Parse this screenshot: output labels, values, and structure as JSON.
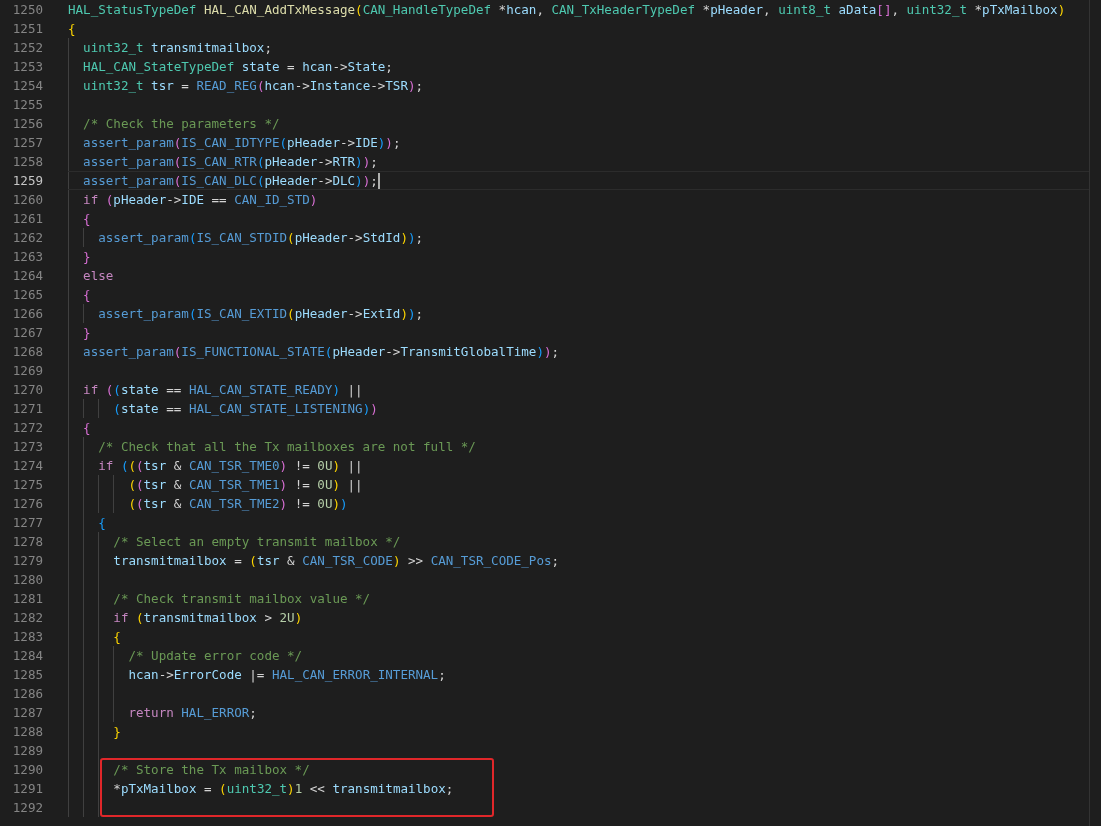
{
  "editor": {
    "lines": [
      {
        "number": "1250",
        "current": false,
        "boxed": false,
        "tokens": [
          {
            "kind": "type",
            "text": "HAL_StatusTypeDef"
          },
          {
            "kind": "function",
            "text": " HAL_CAN_AddTxMessage"
          },
          {
            "kind": "paren1",
            "text": "("
          },
          {
            "kind": "type",
            "text": "CAN_HandleTypeDef"
          },
          {
            "kind": "plain",
            "text": " *"
          },
          {
            "kind": "variable",
            "text": "hcan"
          },
          {
            "kind": "plain",
            "text": ", "
          },
          {
            "kind": "type",
            "text": "CAN_TxHeaderTypeDef"
          },
          {
            "kind": "plain",
            "text": " *"
          },
          {
            "kind": "variable",
            "text": "pHeader"
          },
          {
            "kind": "plain",
            "text": ", "
          },
          {
            "kind": "type",
            "text": "uint8_t"
          },
          {
            "kind": "variable",
            "text": " aData"
          },
          {
            "kind": "paren2",
            "text": "[]"
          },
          {
            "kind": "plain",
            "text": ", "
          },
          {
            "kind": "type",
            "text": "uint32_t"
          },
          {
            "kind": "plain",
            "text": " *"
          },
          {
            "kind": "variable",
            "text": "pTxMailbox"
          },
          {
            "kind": "paren1",
            "text": ")"
          }
        ]
      },
      {
        "number": "1251",
        "current": false,
        "boxed": false,
        "tokens": [
          {
            "kind": "paren1",
            "text": "{"
          }
        ]
      },
      {
        "number": "1252",
        "current": false,
        "boxed": false,
        "tokens": [
          {
            "kind": "type",
            "text": "  uint32_t"
          },
          {
            "kind": "variable",
            "text": " transmitmailbox"
          },
          {
            "kind": "plain",
            "text": ";"
          }
        ]
      },
      {
        "number": "1253",
        "current": false,
        "boxed": false,
        "tokens": [
          {
            "kind": "type",
            "text": "  HAL_CAN_StateTypeDef"
          },
          {
            "kind": "variable",
            "text": " state"
          },
          {
            "kind": "plain",
            "text": " = "
          },
          {
            "kind": "variable",
            "text": "hcan"
          },
          {
            "kind": "plain",
            "text": "->"
          },
          {
            "kind": "variable",
            "text": "State"
          },
          {
            "kind": "plain",
            "text": ";"
          }
        ]
      },
      {
        "number": "1254",
        "current": false,
        "boxed": false,
        "tokens": [
          {
            "kind": "type",
            "text": "  uint32_t"
          },
          {
            "kind": "variable",
            "text": " tsr"
          },
          {
            "kind": "plain",
            "text": " = "
          },
          {
            "kind": "macro",
            "text": "READ_REG"
          },
          {
            "kind": "paren2",
            "text": "("
          },
          {
            "kind": "variable",
            "text": "hcan"
          },
          {
            "kind": "plain",
            "text": "->"
          },
          {
            "kind": "variable",
            "text": "Instance"
          },
          {
            "kind": "plain",
            "text": "->"
          },
          {
            "kind": "variable",
            "text": "TSR"
          },
          {
            "kind": "paren2",
            "text": ")"
          },
          {
            "kind": "plain",
            "text": ";"
          }
        ]
      },
      {
        "number": "1255",
        "current": false,
        "boxed": false
      },
      {
        "number": "1256",
        "current": false,
        "boxed": false,
        "tokens": [
          {
            "kind": "comment",
            "text": "  /* Check the parameters */"
          }
        ]
      },
      {
        "number": "1257",
        "current": false,
        "boxed": false,
        "tokens": [
          {
            "kind": "macro",
            "text": "  assert_param"
          },
          {
            "kind": "paren2",
            "text": "("
          },
          {
            "kind": "macro",
            "text": "IS_CAN_IDTYPE"
          },
          {
            "kind": "paren3",
            "text": "("
          },
          {
            "kind": "variable",
            "text": "pHeader"
          },
          {
            "kind": "plain",
            "text": "->"
          },
          {
            "kind": "variable",
            "text": "IDE"
          },
          {
            "kind": "paren3",
            "text": ")"
          },
          {
            "kind": "paren2",
            "text": ")"
          },
          {
            "kind": "plain",
            "text": ";"
          }
        ]
      },
      {
        "number": "1258",
        "current": false,
        "boxed": false,
        "tokens": [
          {
            "kind": "macro",
            "text": "  assert_param"
          },
          {
            "kind": "paren2",
            "text": "("
          },
          {
            "kind": "macro",
            "text": "IS_CAN_RTR"
          },
          {
            "kind": "paren3",
            "text": "("
          },
          {
            "kind": "variable",
            "text": "pHeader"
          },
          {
            "kind": "plain",
            "text": "->"
          },
          {
            "kind": "variable",
            "text": "RTR"
          },
          {
            "kind": "paren3",
            "text": ")"
          },
          {
            "kind": "paren2",
            "text": ")"
          },
          {
            "kind": "plain",
            "text": ";"
          }
        ]
      },
      {
        "number": "1259",
        "current": true,
        "boxed": false,
        "tokens": [
          {
            "kind": "macro",
            "text": "  assert_param"
          },
          {
            "kind": "paren2",
            "text": "("
          },
          {
            "kind": "macro",
            "text": "IS_CAN_DLC"
          },
          {
            "kind": "paren3",
            "text": "("
          },
          {
            "kind": "variable",
            "text": "pHeader"
          },
          {
            "kind": "plain",
            "text": "->"
          },
          {
            "kind": "variable",
            "text": "DLC"
          },
          {
            "kind": "paren3",
            "text": ")"
          },
          {
            "kind": "paren2",
            "text": ")"
          },
          {
            "kind": "plain",
            "text": ";"
          }
        ]
      },
      {
        "number": "1260",
        "current": false,
        "boxed": false,
        "tokens": [
          {
            "kind": "keyword",
            "text": "  if"
          },
          {
            "kind": "paren2",
            "text": " ("
          },
          {
            "kind": "variable",
            "text": "pHeader"
          },
          {
            "kind": "plain",
            "text": "->"
          },
          {
            "kind": "variable",
            "text": "IDE"
          },
          {
            "kind": "plain",
            "text": " == "
          },
          {
            "kind": "macro",
            "text": "CAN_ID_STD"
          },
          {
            "kind": "paren2",
            "text": ")"
          }
        ]
      },
      {
        "number": "1261",
        "current": false,
        "boxed": false,
        "tokens": [
          {
            "kind": "paren2",
            "text": "  {"
          }
        ]
      },
      {
        "number": "1262",
        "current": false,
        "boxed": false,
        "tokens": [
          {
            "kind": "macro",
            "text": "    assert_param"
          },
          {
            "kind": "paren3",
            "text": "("
          },
          {
            "kind": "macro",
            "text": "IS_CAN_STDID"
          },
          {
            "kind": "paren1",
            "text": "("
          },
          {
            "kind": "variable",
            "text": "pHeader"
          },
          {
            "kind": "plain",
            "text": "->"
          },
          {
            "kind": "variable",
            "text": "StdId"
          },
          {
            "kind": "paren1",
            "text": ")"
          },
          {
            "kind": "paren3",
            "text": ")"
          },
          {
            "kind": "plain",
            "text": ";"
          }
        ]
      },
      {
        "number": "1263",
        "current": false,
        "boxed": false,
        "tokens": [
          {
            "kind": "paren2",
            "text": "  }"
          }
        ]
      },
      {
        "number": "1264",
        "current": false,
        "boxed": false,
        "tokens": [
          {
            "kind": "keyword",
            "text": "  else"
          }
        ]
      },
      {
        "number": "1265",
        "current": false,
        "boxed": false,
        "tokens": [
          {
            "kind": "paren2",
            "text": "  {"
          }
        ]
      },
      {
        "number": "1266",
        "current": false,
        "boxed": false,
        "tokens": [
          {
            "kind": "macro",
            "text": "    assert_param"
          },
          {
            "kind": "paren3",
            "text": "("
          },
          {
            "kind": "macro",
            "text": "IS_CAN_EXTID"
          },
          {
            "kind": "paren1",
            "text": "("
          },
          {
            "kind": "variable",
            "text": "pHeader"
          },
          {
            "kind": "plain",
            "text": "->"
          },
          {
            "kind": "variable",
            "text": "ExtId"
          },
          {
            "kind": "paren1",
            "text": ")"
          },
          {
            "kind": "paren3",
            "text": ")"
          },
          {
            "kind": "plain",
            "text": ";"
          }
        ]
      },
      {
        "number": "1267",
        "current": false,
        "boxed": false,
        "tokens": [
          {
            "kind": "paren2",
            "text": "  }"
          }
        ]
      },
      {
        "number": "1268",
        "current": false,
        "boxed": false,
        "tokens": [
          {
            "kind": "macro",
            "text": "  assert_param"
          },
          {
            "kind": "paren2",
            "text": "("
          },
          {
            "kind": "macro",
            "text": "IS_FUNCTIONAL_STATE"
          },
          {
            "kind": "paren3",
            "text": "("
          },
          {
            "kind": "variable",
            "text": "pHeader"
          },
          {
            "kind": "plain",
            "text": "->"
          },
          {
            "kind": "variable",
            "text": "TransmitGlobalTime"
          },
          {
            "kind": "paren3",
            "text": ")"
          },
          {
            "kind": "paren2",
            "text": ")"
          },
          {
            "kind": "plain",
            "text": ";"
          }
        ]
      },
      {
        "number": "1269",
        "current": false,
        "boxed": false
      },
      {
        "number": "1270",
        "current": false,
        "boxed": false,
        "tokens": [
          {
            "kind": "keyword",
            "text": "  if"
          },
          {
            "kind": "paren2",
            "text": " ("
          },
          {
            "kind": "paren3",
            "text": "("
          },
          {
            "kind": "variable",
            "text": "state"
          },
          {
            "kind": "plain",
            "text": " == "
          },
          {
            "kind": "macro",
            "text": "HAL_CAN_STATE_READY"
          },
          {
            "kind": "paren3",
            "text": ")"
          },
          {
            "kind": "plain",
            "text": " ||"
          }
        ]
      },
      {
        "number": "1271",
        "current": false,
        "boxed": false,
        "tokens": [
          {
            "kind": "paren3",
            "text": "      ("
          },
          {
            "kind": "variable",
            "text": "state"
          },
          {
            "kind": "plain",
            "text": " == "
          },
          {
            "kind": "macro",
            "text": "HAL_CAN_STATE_LISTENING"
          },
          {
            "kind": "paren3",
            "text": ")"
          },
          {
            "kind": "paren2",
            "text": ")"
          }
        ]
      },
      {
        "number": "1272",
        "current": false,
        "boxed": false,
        "tokens": [
          {
            "kind": "paren2",
            "text": "  {"
          }
        ]
      },
      {
        "number": "1273",
        "current": false,
        "boxed": false,
        "tokens": [
          {
            "kind": "comment",
            "text": "    /* Check that all the Tx mailboxes are not full */"
          }
        ]
      },
      {
        "number": "1274",
        "current": false,
        "boxed": false,
        "tokens": [
          {
            "kind": "keyword",
            "text": "    if"
          },
          {
            "kind": "paren3",
            "text": " ("
          },
          {
            "kind": "paren1",
            "text": "("
          },
          {
            "kind": "paren2",
            "text": "("
          },
          {
            "kind": "variable",
            "text": "tsr"
          },
          {
            "kind": "plain",
            "text": " & "
          },
          {
            "kind": "macro",
            "text": "CAN_TSR_TME0"
          },
          {
            "kind": "paren2",
            "text": ")"
          },
          {
            "kind": "plain",
            "text": " != "
          },
          {
            "kind": "number",
            "text": "0U"
          },
          {
            "kind": "paren1",
            "text": ")"
          },
          {
            "kind": "plain",
            "text": " ||"
          }
        ]
      },
      {
        "number": "1275",
        "current": false,
        "boxed": false,
        "tokens": [
          {
            "kind": "paren1",
            "text": "        ("
          },
          {
            "kind": "paren2",
            "text": "("
          },
          {
            "kind": "variable",
            "text": "tsr"
          },
          {
            "kind": "plain",
            "text": " & "
          },
          {
            "kind": "macro",
            "text": "CAN_TSR_TME1"
          },
          {
            "kind": "paren2",
            "text": ")"
          },
          {
            "kind": "plain",
            "text": " != "
          },
          {
            "kind": "number",
            "text": "0U"
          },
          {
            "kind": "paren1",
            "text": ")"
          },
          {
            "kind": "plain",
            "text": " ||"
          }
        ]
      },
      {
        "number": "1276",
        "current": false,
        "boxed": false,
        "tokens": [
          {
            "kind": "paren1",
            "text": "        ("
          },
          {
            "kind": "paren2",
            "text": "("
          },
          {
            "kind": "variable",
            "text": "tsr"
          },
          {
            "kind": "plain",
            "text": " & "
          },
          {
            "kind": "macro",
            "text": "CAN_TSR_TME2"
          },
          {
            "kind": "paren2",
            "text": ")"
          },
          {
            "kind": "plain",
            "text": " != "
          },
          {
            "kind": "number",
            "text": "0U"
          },
          {
            "kind": "paren1",
            "text": ")"
          },
          {
            "kind": "paren3",
            "text": ")"
          }
        ]
      },
      {
        "number": "1277",
        "current": false,
        "boxed": false,
        "tokens": [
          {
            "kind": "paren3",
            "text": "    {"
          }
        ]
      },
      {
        "number": "1278",
        "current": false,
        "boxed": false,
        "tokens": [
          {
            "kind": "comment",
            "text": "      /* Select an empty transmit mailbox */"
          }
        ]
      },
      {
        "number": "1279",
        "current": false,
        "boxed": false,
        "tokens": [
          {
            "kind": "variable",
            "text": "      transmitmailbox"
          },
          {
            "kind": "plain",
            "text": " = "
          },
          {
            "kind": "paren1",
            "text": "("
          },
          {
            "kind": "variable",
            "text": "tsr"
          },
          {
            "kind": "plain",
            "text": " & "
          },
          {
            "kind": "macro",
            "text": "CAN_TSR_CODE"
          },
          {
            "kind": "paren1",
            "text": ")"
          },
          {
            "kind": "plain",
            "text": " >> "
          },
          {
            "kind": "macro",
            "text": "CAN_TSR_CODE_Pos"
          },
          {
            "kind": "plain",
            "text": ";"
          }
        ]
      },
      {
        "number": "1280",
        "current": false,
        "boxed": false
      },
      {
        "number": "1281",
        "current": false,
        "boxed": false,
        "tokens": [
          {
            "kind": "comment",
            "text": "      /* Check transmit mailbox value */"
          }
        ]
      },
      {
        "number": "1282",
        "current": false,
        "boxed": false,
        "tokens": [
          {
            "kind": "keyword",
            "text": "      if"
          },
          {
            "kind": "paren1",
            "text": " ("
          },
          {
            "kind": "variable",
            "text": "transmitmailbox"
          },
          {
            "kind": "plain",
            "text": " > "
          },
          {
            "kind": "number",
            "text": "2U"
          },
          {
            "kind": "paren1",
            "text": ")"
          }
        ]
      },
      {
        "number": "1283",
        "current": false,
        "boxed": false,
        "tokens": [
          {
            "kind": "paren1",
            "text": "      {"
          }
        ]
      },
      {
        "number": "1284",
        "current": false,
        "boxed": false,
        "tokens": [
          {
            "kind": "comment",
            "text": "        /* Update error code */"
          }
        ]
      },
      {
        "number": "1285",
        "current": false,
        "boxed": false,
        "tokens": [
          {
            "kind": "variable",
            "text": "        hcan"
          },
          {
            "kind": "plain",
            "text": "->"
          },
          {
            "kind": "variable",
            "text": "ErrorCode"
          },
          {
            "kind": "plain",
            "text": " |= "
          },
          {
            "kind": "macro",
            "text": "HAL_CAN_ERROR_INTERNAL"
          },
          {
            "kind": "plain",
            "text": ";"
          }
        ]
      },
      {
        "number": "1286",
        "current": false,
        "boxed": false
      },
      {
        "number": "1287",
        "current": false,
        "boxed": false,
        "tokens": [
          {
            "kind": "keyword",
            "text": "        return"
          },
          {
            "kind": "macro",
            "text": " HAL_ERROR"
          },
          {
            "kind": "plain",
            "text": ";"
          }
        ]
      },
      {
        "number": "1288",
        "current": false,
        "boxed": false,
        "tokens": [
          {
            "kind": "paren1",
            "text": "      }"
          }
        ]
      },
      {
        "number": "1289",
        "current": false,
        "boxed": false
      },
      {
        "number": "1290",
        "current": false,
        "boxed": true,
        "tokens": [
          {
            "kind": "comment",
            "text": "      /* Store the Tx mailbox */"
          }
        ]
      },
      {
        "number": "1291",
        "current": false,
        "boxed": true,
        "tokens": [
          {
            "kind": "plain",
            "text": "      *"
          },
          {
            "kind": "variable",
            "text": "pTxMailbox"
          },
          {
            "kind": "plain",
            "text": " = "
          },
          {
            "kind": "paren1",
            "text": "("
          },
          {
            "kind": "type",
            "text": "uint32_t"
          },
          {
            "kind": "paren1",
            "text": ")"
          },
          {
            "kind": "number",
            "text": "1"
          },
          {
            "kind": "plain",
            "text": " << "
          },
          {
            "kind": "variable",
            "text": "transmitmailbox"
          },
          {
            "kind": "plain",
            "text": ";"
          }
        ]
      },
      {
        "number": "1292",
        "current": false,
        "boxed": true
      }
    ]
  }
}
